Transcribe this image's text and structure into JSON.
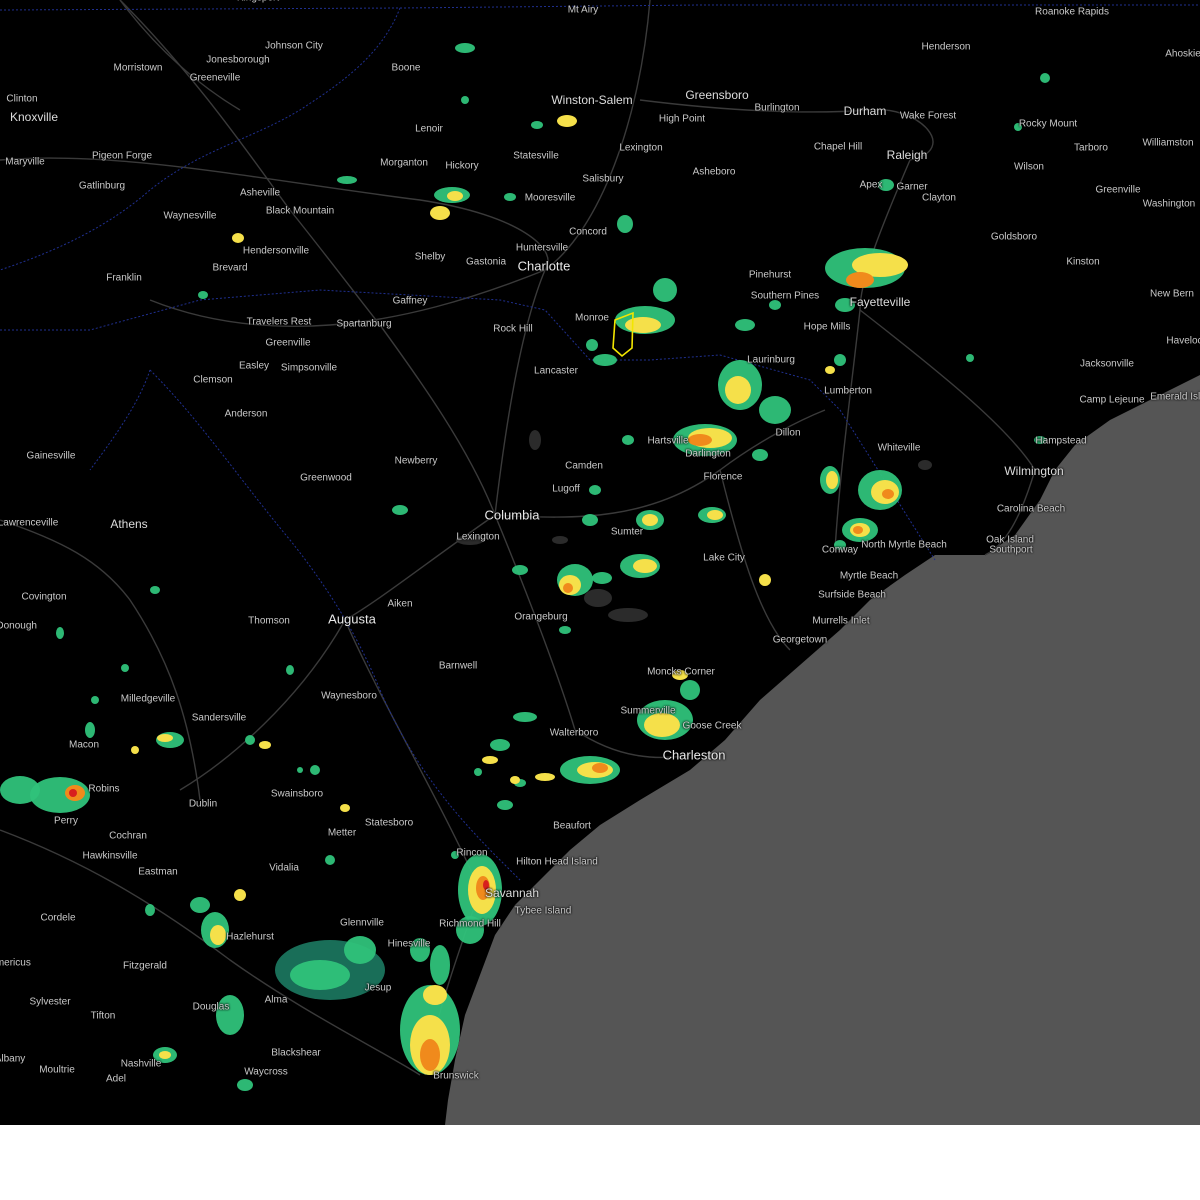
{
  "map": {
    "colors": {
      "land": "#000000",
      "ocean": "#555555",
      "roads": "#3a3a3a",
      "state_borders": "#1f2f8f",
      "water": "#2b2b2b",
      "radar_light": "#1f8a6e",
      "radar_green": "#2fc27a",
      "radar_yellow": "#f5e04a",
      "radar_orange": "#f08a1c",
      "radar_red": "#d81e1e",
      "warning_box": "#f2e600"
    },
    "cities": [
      {
        "name": "Kingsport",
        "size": "small"
      },
      {
        "name": "Mt Airy",
        "size": "small"
      },
      {
        "name": "Roanoke Rapids",
        "size": "small"
      },
      {
        "name": "Johnson City",
        "size": "small"
      },
      {
        "name": "Henderson",
        "size": "small"
      },
      {
        "name": "Ahoskie",
        "size": "small"
      },
      {
        "name": "Morristown",
        "size": "small"
      },
      {
        "name": "Jonesborough",
        "size": "small"
      },
      {
        "name": "Boone",
        "size": "small"
      },
      {
        "name": "Greeneville",
        "size": "small"
      },
      {
        "name": "Winston-Salem",
        "size": "med"
      },
      {
        "name": "Greensboro",
        "size": "med"
      },
      {
        "name": "Clinton",
        "size": "small"
      },
      {
        "name": "Burlington",
        "size": "small"
      },
      {
        "name": "Durham",
        "size": "med"
      },
      {
        "name": "Knoxville",
        "size": "med"
      },
      {
        "name": "High Point",
        "size": "small"
      },
      {
        "name": "Wake Forest",
        "size": "small"
      },
      {
        "name": "Rocky Mount",
        "size": "small"
      },
      {
        "name": "Lenoir",
        "size": "small"
      },
      {
        "name": "Williamston",
        "size": "small"
      },
      {
        "name": "Pigeon Forge",
        "size": "small"
      },
      {
        "name": "Lexington",
        "size": "small"
      },
      {
        "name": "Chapel Hill",
        "size": "small"
      },
      {
        "name": "Tarboro",
        "size": "small"
      },
      {
        "name": "Statesville",
        "size": "small"
      },
      {
        "name": "Raleigh",
        "size": "med"
      },
      {
        "name": "Maryville",
        "size": "small"
      },
      {
        "name": "Morganton",
        "size": "small"
      },
      {
        "name": "Hickory",
        "size": "small"
      },
      {
        "name": "Asheboro",
        "size": "small"
      },
      {
        "name": "Wilson",
        "size": "small"
      },
      {
        "name": "Salisbury",
        "size": "small"
      },
      {
        "name": "Gatlinburg",
        "size": "small"
      },
      {
        "name": "Apex",
        "size": "small"
      },
      {
        "name": "Garner",
        "size": "small"
      },
      {
        "name": "Greenville",
        "size": "small"
      },
      {
        "name": "Asheville",
        "size": "small"
      },
      {
        "name": "Mooresville",
        "size": "small"
      },
      {
        "name": "Clayton",
        "size": "small"
      },
      {
        "name": "Black Mountain",
        "size": "small"
      },
      {
        "name": "Washington",
        "size": "small"
      },
      {
        "name": "Waynesville",
        "size": "small"
      },
      {
        "name": "Concord",
        "size": "small"
      },
      {
        "name": "Goldsboro",
        "size": "small"
      },
      {
        "name": "Hendersonville",
        "size": "small"
      },
      {
        "name": "Huntersville",
        "size": "small"
      },
      {
        "name": "Brevard",
        "size": "small"
      },
      {
        "name": "Shelby",
        "size": "small"
      },
      {
        "name": "Gastonia",
        "size": "small"
      },
      {
        "name": "Charlotte",
        "size": "major"
      },
      {
        "name": "Kinston",
        "size": "small"
      },
      {
        "name": "Franklin",
        "size": "small"
      },
      {
        "name": "Pinehurst",
        "size": "small"
      },
      {
        "name": "Gaffney",
        "size": "small"
      },
      {
        "name": "Southern Pines",
        "size": "small"
      },
      {
        "name": "New Bern",
        "size": "small"
      },
      {
        "name": "Fayetteville",
        "size": "med"
      },
      {
        "name": "Travelers Rest",
        "size": "small"
      },
      {
        "name": "Spartanburg",
        "size": "small"
      },
      {
        "name": "Monroe",
        "size": "small"
      },
      {
        "name": "Hope Mills",
        "size": "small"
      },
      {
        "name": "Havelock",
        "size": "small"
      },
      {
        "name": "Rock Hill",
        "size": "small"
      },
      {
        "name": "Greenville",
        "size": "small"
      },
      {
        "name": "Easley",
        "size": "small"
      },
      {
        "name": "Simpsonville",
        "size": "small"
      },
      {
        "name": "Laurinburg",
        "size": "small"
      },
      {
        "name": "Jacksonville",
        "size": "small"
      },
      {
        "name": "Clemson",
        "size": "small"
      },
      {
        "name": "Lancaster",
        "size": "small"
      },
      {
        "name": "Lumberton",
        "size": "small"
      },
      {
        "name": "Camp Lejeune",
        "size": "small"
      },
      {
        "name": "Emerald Isle",
        "size": "small"
      },
      {
        "name": "Anderson",
        "size": "small"
      },
      {
        "name": "Dillon",
        "size": "small"
      },
      {
        "name": "Hartsville",
        "size": "small"
      },
      {
        "name": "Hampstead",
        "size": "small"
      },
      {
        "name": "Darlington",
        "size": "small"
      },
      {
        "name": "Whiteville",
        "size": "small"
      },
      {
        "name": "Gainesville",
        "size": "small"
      },
      {
        "name": "Newberry",
        "size": "small"
      },
      {
        "name": "Camden",
        "size": "small"
      },
      {
        "name": "Wilmington",
        "size": "med"
      },
      {
        "name": "Florence",
        "size": "small"
      },
      {
        "name": "Greenwood",
        "size": "small"
      },
      {
        "name": "Lugoff",
        "size": "small"
      },
      {
        "name": "Carolina Beach",
        "size": "small"
      },
      {
        "name": "Columbia",
        "size": "major"
      },
      {
        "name": "Lawrenceville",
        "size": "small"
      },
      {
        "name": "Athens",
        "size": "med"
      },
      {
        "name": "Sumter",
        "size": "small"
      },
      {
        "name": "Lexington",
        "size": "small"
      },
      {
        "name": "Oak Island",
        "size": "small"
      },
      {
        "name": "North Myrtle Beach",
        "size": "small"
      },
      {
        "name": "Conway",
        "size": "small"
      },
      {
        "name": "Southport",
        "size": "small"
      },
      {
        "name": "Lake City",
        "size": "small"
      },
      {
        "name": "Myrtle Beach",
        "size": "small"
      },
      {
        "name": "Covington",
        "size": "small"
      },
      {
        "name": "Aiken",
        "size": "small"
      },
      {
        "name": "Surfside Beach",
        "size": "small"
      },
      {
        "name": "Augusta",
        "size": "major"
      },
      {
        "name": "Thomson",
        "size": "small"
      },
      {
        "name": "Orangeburg",
        "size": "small"
      },
      {
        "name": "Murrells Inlet",
        "size": "small"
      },
      {
        "name": "McDonough",
        "size": "small"
      },
      {
        "name": "Georgetown",
        "size": "small"
      },
      {
        "name": "Barnwell",
        "size": "small"
      },
      {
        "name": "Moncks Corner",
        "size": "small"
      },
      {
        "name": "Milledgeville",
        "size": "small"
      },
      {
        "name": "Waynesboro",
        "size": "small"
      },
      {
        "name": "Sandersville",
        "size": "small"
      },
      {
        "name": "Summerville",
        "size": "small"
      },
      {
        "name": "Goose Creek",
        "size": "small"
      },
      {
        "name": "Walterboro",
        "size": "small"
      },
      {
        "name": "Macon",
        "size": "small"
      },
      {
        "name": "Charleston",
        "size": "major"
      },
      {
        "name": "Robins",
        "size": "small"
      },
      {
        "name": "Swainsboro",
        "size": "small"
      },
      {
        "name": "Dublin",
        "size": "small"
      },
      {
        "name": "Perry",
        "size": "small"
      },
      {
        "name": "Statesboro",
        "size": "small"
      },
      {
        "name": "Beaufort",
        "size": "small"
      },
      {
        "name": "Metter",
        "size": "small"
      },
      {
        "name": "Cochran",
        "size": "small"
      },
      {
        "name": "Rincon",
        "size": "small"
      },
      {
        "name": "Hilton Head Island",
        "size": "small"
      },
      {
        "name": "Hawkinsville",
        "size": "small"
      },
      {
        "name": "Vidalia",
        "size": "small"
      },
      {
        "name": "Eastman",
        "size": "small"
      },
      {
        "name": "Savannah",
        "size": "med"
      },
      {
        "name": "Tybee Island",
        "size": "small"
      },
      {
        "name": "Cordele",
        "size": "small"
      },
      {
        "name": "Glennville",
        "size": "small"
      },
      {
        "name": "Richmond Hill",
        "size": "small"
      },
      {
        "name": "Hazlehurst",
        "size": "small"
      },
      {
        "name": "Hinesville",
        "size": "small"
      },
      {
        "name": "Americus",
        "size": "small"
      },
      {
        "name": "Fitzgerald",
        "size": "small"
      },
      {
        "name": "Jesup",
        "size": "small"
      },
      {
        "name": "Sylvester",
        "size": "small"
      },
      {
        "name": "Douglas",
        "size": "small"
      },
      {
        "name": "Alma",
        "size": "small"
      },
      {
        "name": "Albany",
        "size": "small"
      },
      {
        "name": "Tifton",
        "size": "small"
      },
      {
        "name": "Brunswick",
        "size": "small"
      },
      {
        "name": "Blackshear",
        "size": "small"
      },
      {
        "name": "Nashville",
        "size": "small"
      },
      {
        "name": "Waycross",
        "size": "small"
      },
      {
        "name": "Moultrie",
        "size": "small"
      },
      {
        "name": "Adel",
        "size": "small"
      }
    ]
  }
}
